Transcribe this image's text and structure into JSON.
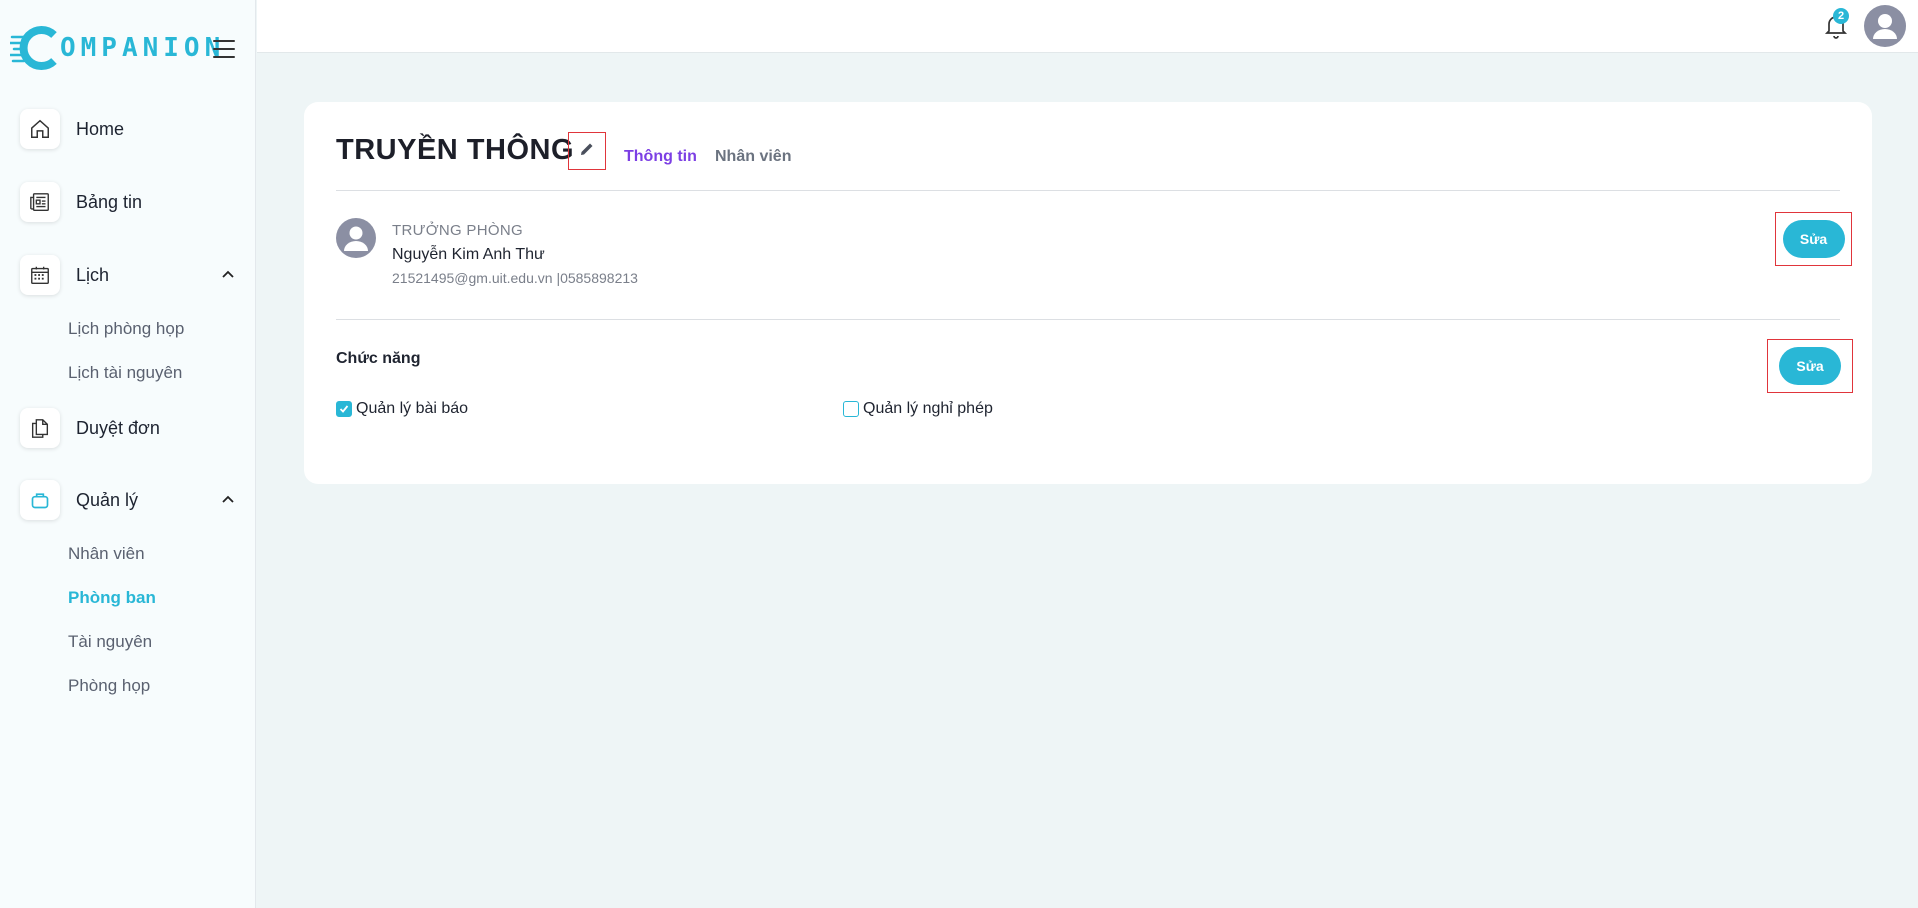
{
  "brand": {
    "name": "OMPANION",
    "logo_letter": "C",
    "color": "#29b7d6"
  },
  "sidebar": {
    "items": [
      {
        "label": "Home",
        "icon": "home-icon"
      },
      {
        "label": "Bảng tin",
        "icon": "newspaper-icon"
      },
      {
        "label": "Lịch",
        "icon": "calendar-icon",
        "expanded": true,
        "children": [
          {
            "label": "Lịch phòng họp"
          },
          {
            "label": "Lịch tài nguyên"
          }
        ]
      },
      {
        "label": "Duyệt đơn",
        "icon": "documents-icon"
      },
      {
        "label": "Quản lý",
        "icon": "briefcase-icon",
        "expanded": true,
        "children": [
          {
            "label": "Nhân viên"
          },
          {
            "label": "Phòng ban",
            "active": true
          },
          {
            "label": "Tài nguyên"
          },
          {
            "label": "Phòng họp"
          }
        ]
      }
    ]
  },
  "header": {
    "notification_count": "2"
  },
  "department": {
    "title": "TRUYỀN THÔNG",
    "tabs": [
      {
        "label": "Thông tin",
        "active": true
      },
      {
        "label": "Nhân viên"
      }
    ],
    "head": {
      "role": "TRƯỞNG PHÒNG",
      "name": "Nguyễn Kim Anh Thư",
      "contact": "21521495@gm.uit.edu.vn |0585898213",
      "edit_label": "Sửa"
    },
    "functions": {
      "title": "Chức năng",
      "edit_label": "Sửa",
      "permissions": [
        {
          "label": "Quản lý bài báo",
          "checked": true
        },
        {
          "label": "Quản lý nghỉ phép",
          "checked": false
        }
      ]
    }
  },
  "colors": {
    "accent": "#29b7d6",
    "tab_active": "#7c3fe4",
    "highlight_border": "#e0353b",
    "background": "#eef5f6"
  }
}
